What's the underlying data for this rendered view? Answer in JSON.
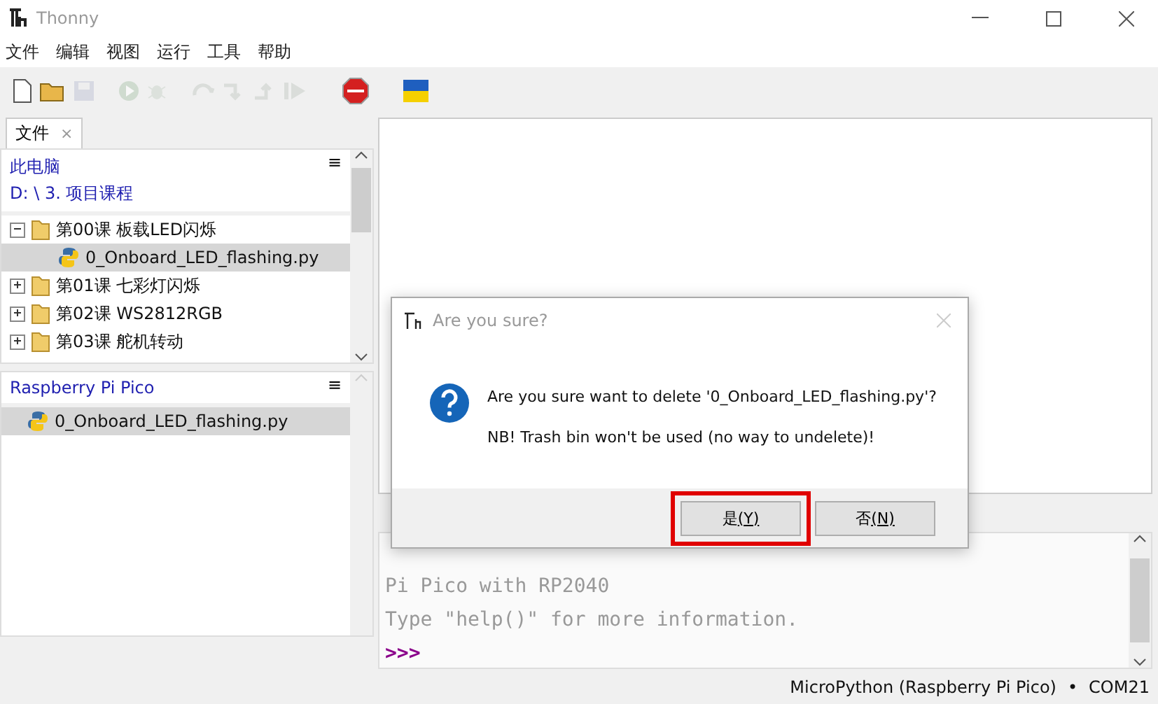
{
  "window": {
    "title": "Thonny"
  },
  "menu": [
    "文件",
    "编辑",
    "视图",
    "运行",
    "工具",
    "帮助"
  ],
  "toolbar": [
    {
      "kind": "new",
      "disabled": false
    },
    {
      "kind": "open",
      "disabled": false
    },
    {
      "kind": "save",
      "disabled": true
    },
    {
      "kind": "sep"
    },
    {
      "kind": "run",
      "disabled": true
    },
    {
      "kind": "debug",
      "disabled": true
    },
    {
      "kind": "sep"
    },
    {
      "kind": "over",
      "disabled": true
    },
    {
      "kind": "into",
      "disabled": true
    },
    {
      "kind": "out",
      "disabled": true
    },
    {
      "kind": "resume",
      "disabled": true
    },
    {
      "kind": "sep"
    },
    {
      "kind": "stop",
      "disabled": false
    },
    {
      "kind": "sep"
    },
    {
      "kind": "flag",
      "disabled": false
    }
  ],
  "files_tab": {
    "label": "文件",
    "close": "×"
  },
  "local": {
    "title": "此电脑",
    "path": "D: \\ 3. 项目课程",
    "menu": "≡",
    "items": [
      {
        "name": "第00课 板载LED闪烁",
        "kind": "folder",
        "expanded": true,
        "selected": false,
        "children": [
          {
            "name": "0_Onboard_LED_flashing.py",
            "kind": "python",
            "selected": true
          }
        ]
      },
      {
        "name": "第01课 七彩灯闪烁",
        "kind": "folder",
        "expanded": false,
        "selected": false
      },
      {
        "name": "第02课 WS2812RGB",
        "kind": "folder",
        "expanded": false,
        "selected": false
      },
      {
        "name": "第03课 舵机转动",
        "kind": "folder",
        "expanded": false,
        "selected": false
      }
    ]
  },
  "device": {
    "title": "Raspberry Pi Pico",
    "menu": "≡",
    "items": [
      {
        "name": "0_Onboard_LED_flashing.py",
        "kind": "python",
        "selected": true
      }
    ]
  },
  "shell": {
    "lines": [
      "Pi Pico with RP2040",
      "Type \"help()\" for more information."
    ],
    "prompt": ">>>"
  },
  "status_bar": {
    "interpreter": "MicroPython (Raspberry Pi Pico)",
    "separator": "•",
    "port": "COM21"
  },
  "dialog": {
    "title": "Are you sure?",
    "message": "Are you sure want to delete '0_Onboard_LED_flashing.py'?",
    "note": "NB! Trash bin won't be used (no way to undelete)!",
    "buttons": [
      {
        "label": "是",
        "accel": "(Y)",
        "highlighted": true
      },
      {
        "label": "否",
        "accel": "(N)",
        "highlighted": false
      }
    ]
  }
}
